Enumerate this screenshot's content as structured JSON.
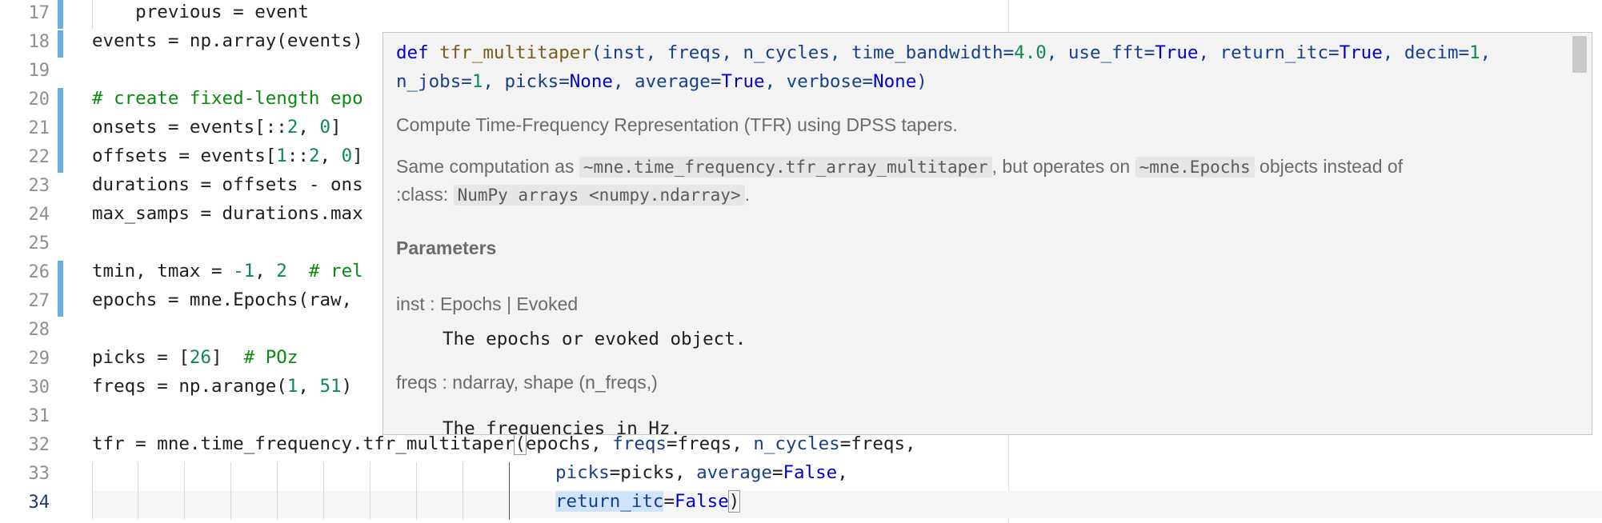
{
  "editor": {
    "line_numbers": [
      "17",
      "18",
      "19",
      "20",
      "21",
      "22",
      "23",
      "24",
      "25",
      "26",
      "27",
      "28",
      "29",
      "30",
      "31",
      "32",
      "33",
      "34"
    ],
    "current_line": "34",
    "lines": {
      "l17": "    previous = event",
      "l18": "events = np.array(events)",
      "l20": "# create fixed-length epo",
      "l21a": "onsets = events[::",
      "l21b": "2",
      "l21c": ", ",
      "l21d": "0",
      "l21e": "]",
      "l22a": "offsets = events[",
      "l22b": "1",
      "l22c": "::",
      "l22d": "2",
      "l22e": ", ",
      "l22f": "0",
      "l22g": "]",
      "l23": "durations = offsets - ons",
      "l24": "max_samps = durations.max",
      "l26a": "tmin, tmax = ",
      "l26b": "-1",
      "l26c": ", ",
      "l26d": "2",
      "l26e": "  # rel",
      "l27": "epochs = mne.Epochs(raw, ",
      "l29a": "picks = [",
      "l29b": "26",
      "l29c": "]  ",
      "l29d": "# POz",
      "l30a": "freqs = np.arange(",
      "l30b": "1",
      "l30c": ", ",
      "l30d": "51",
      "l30e": ")",
      "l32a": "tfr = mne.time_frequency.",
      "l32b": "tfr_multitaper",
      "l32c": "(",
      "l32d": "epochs, ",
      "l32e": "freqs",
      "l32f": "=freqs, ",
      "l32g": "n_cycles",
      "l32h": "=freqs,",
      "l33a": "picks",
      "l33b": "=picks, ",
      "l33c": "average",
      "l33d": "=",
      "l33e": "False",
      "l33f": ",",
      "l34a": "return_itc",
      "l34b": "=",
      "l34c": "False",
      "l34d": ")"
    }
  },
  "popup": {
    "sig1": {
      "def": "def ",
      "name": "tfr_multitaper",
      "p1": "(inst, freqs, n_cycles, time_bandwidth=",
      "v1": "4.0",
      "p2": ", use_fft=",
      "v2": "True",
      "p3": ", return_itc=",
      "v3": "True",
      "p4": ", decim=",
      "v4": "1",
      "p5": ","
    },
    "sig2": {
      "p1": "n_jobs=",
      "v1": "1",
      "p2": ", picks=",
      "v2": "None",
      "p3": ", average=",
      "v3": "True",
      "p4": ", verbose=",
      "v4": "None",
      "p5": ")"
    },
    "summary": "Compute Time-Frequency Representation (TFR) using DPSS tapers.",
    "same_a": "Same computation as ",
    "same_code1": "~mne.time_frequency.tfr_array_multitaper",
    "same_b": ", but operates on ",
    "same_code2": "~mne.Epochs",
    "same_c": " objects instead of",
    "class_a": ":class: ",
    "class_code": "NumPy arrays <numpy.ndarray>",
    "class_b": ".",
    "parameters_heading": "Parameters",
    "param_inst": "inst : Epochs | Evoked",
    "param_inst_desc": "The epochs or evoked object.",
    "param_freqs": "freqs : ndarray, shape (n_freqs,)",
    "param_freqs_desc": "The frequencies in Hz."
  },
  "colors": {
    "keyword": "#0000cc",
    "number": "#0a8a54",
    "comment": "#0a8a10",
    "function": "#7b5b17",
    "parameter": "#16408c",
    "modified_bar": "#6aaee6"
  }
}
